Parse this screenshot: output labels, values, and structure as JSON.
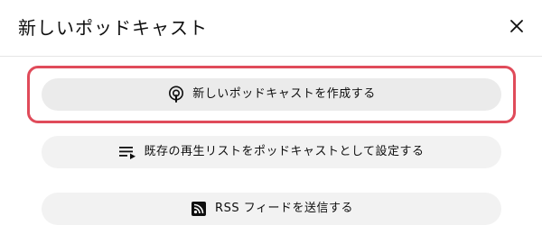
{
  "dialog": {
    "title": "新しいポッドキャスト",
    "close_icon": "close-icon"
  },
  "options": [
    {
      "label": "新しいポッドキャストを作成する",
      "icon": "podcast-icon",
      "selected": true
    },
    {
      "label": "既存の再生リストをポッドキャストとして設定する",
      "icon": "playlist-add-icon",
      "selected": false
    },
    {
      "label": "RSS フィードを送信する",
      "icon": "rss-feed-icon",
      "selected": false
    }
  ],
  "colors": {
    "highlight_ring": "#e04b5a",
    "button_bg": "#f2f2f2"
  }
}
